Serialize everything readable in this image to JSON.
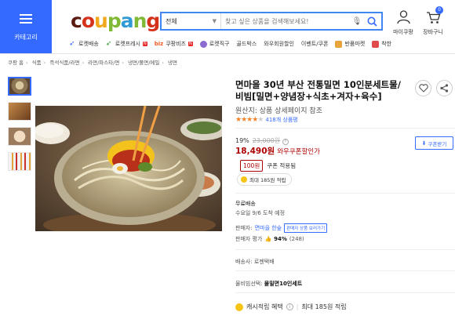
{
  "header": {
    "category_label": "카테고리",
    "logo": "coupang",
    "search": {
      "category": "전체",
      "placeholder": "찾고 싶은 상품을 검색해보세요!"
    },
    "my_coupang": "마이쿠팡",
    "cart": "장바구니",
    "cart_count": "0",
    "nav": [
      {
        "label": "로켓배송",
        "badge": ""
      },
      {
        "label": "로켓프레시",
        "badge": "N"
      },
      {
        "label": "쿠팡비즈",
        "badge": "N",
        "prefix": "biz"
      },
      {
        "label": "로켓직구",
        "badge": ""
      },
      {
        "label": "골드박스",
        "badge": ""
      },
      {
        "label": "와우회원할인",
        "badge": ""
      },
      {
        "label": "이벤트/쿠폰",
        "badge": ""
      },
      {
        "label": "반품마켓",
        "badge": ""
      },
      {
        "label": "착한",
        "badge": ""
      }
    ]
  },
  "breadcrumb": [
    "쿠팡 홈",
    "식품",
    "즉석식품/라면",
    "라면/파스타/면",
    "냉면/쫄면/메밀",
    "냉면"
  ],
  "product": {
    "title": "면마을 30년 부산 전통밀면 10인분세트물/비빔[밀면+양념장+식초+겨자+육수]",
    "origin": "원산지: 상품 상세페이지 참조",
    "review_count": "418개 상품평",
    "rating": 4.5,
    "discount_rate": "19%",
    "original_price": "23,000원",
    "price": "18,490원",
    "price_label": "와우쿠폰할인가",
    "coupon_btn": "쿠폰받기",
    "coupon_amount": "100원",
    "coupon_text": "쿠폰 적용됨",
    "cash_text": "최대 185원 적립",
    "shipping_title": "무료배송",
    "shipping_sub": "수요일 9/6 도착 예정",
    "seller_label": "판매자:",
    "seller_name": "면마을 한숲",
    "seller_btn": "판매자 상품 보러가기",
    "seller_rating_label": "판매자 평가",
    "seller_rating_value": "94%",
    "seller_rating_count": "(248)",
    "delivery_label": "배송사:",
    "delivery_value": "로젠택배",
    "option_label": "물비빔선택:",
    "option_value": "물밀면10인세트",
    "cash_benefit": "캐시적립 혜택",
    "cash_benefit_detail": "최대 185원 적립"
  },
  "colors": {
    "accent": "#346aff",
    "price": "#ae0000",
    "star": "#f1852d"
  }
}
